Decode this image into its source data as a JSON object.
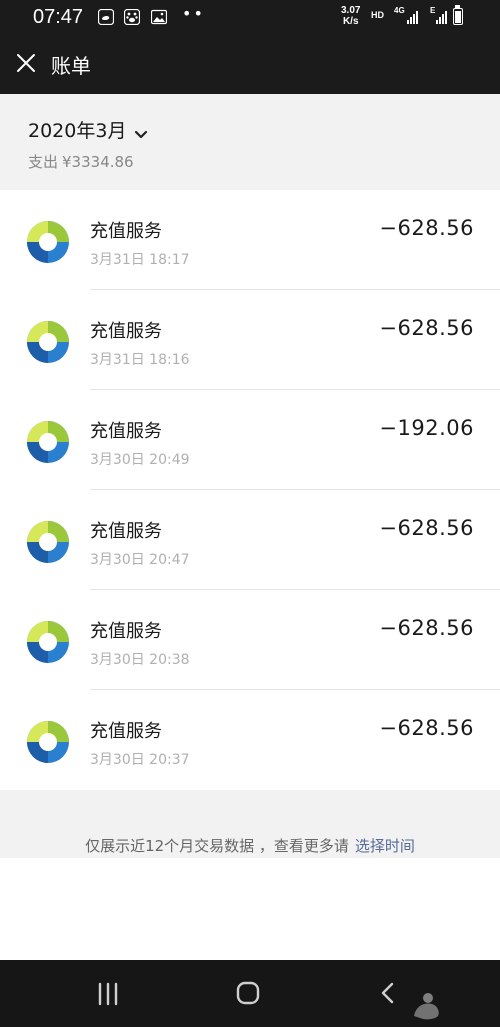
{
  "status_bar": {
    "time": "07:47",
    "speed_value": "3.07",
    "speed_unit": "K/s",
    "hd_label": "HD",
    "network_primary": "4G",
    "network_secondary": "E",
    "icons": [
      "weibo-icon",
      "baidu-icon",
      "gallery-icon",
      "more-dots-icon",
      "signal-icon",
      "battery-icon"
    ]
  },
  "header": {
    "title": "账单",
    "close_icon": "close-icon"
  },
  "summary": {
    "month": "2020年3月",
    "expense_label": "支出",
    "expense_amount": "¥3334.86"
  },
  "transactions": [
    {
      "name": "充值服务",
      "datetime": "3月31日 18:17",
      "amount": "−628.56"
    },
    {
      "name": "充值服务",
      "datetime": "3月31日 18:16",
      "amount": "−628.56"
    },
    {
      "name": "充值服务",
      "datetime": "3月30日 20:49",
      "amount": "−192.06"
    },
    {
      "name": "充值服务",
      "datetime": "3月30日 20:47",
      "amount": "−628.56"
    },
    {
      "name": "充值服务",
      "datetime": "3月30日 20:38",
      "amount": "−628.56"
    },
    {
      "name": "充值服务",
      "datetime": "3月30日 20:37",
      "amount": "−628.56"
    }
  ],
  "footer": {
    "note": "仅展示近12个月交易数据 ，查看更多请",
    "link": "选择时间"
  },
  "colors": {
    "dark_bar": "#1b1b1b",
    "link": "#576b95",
    "muted": "#b0b0b0",
    "section_bg": "#f2f2f2"
  }
}
